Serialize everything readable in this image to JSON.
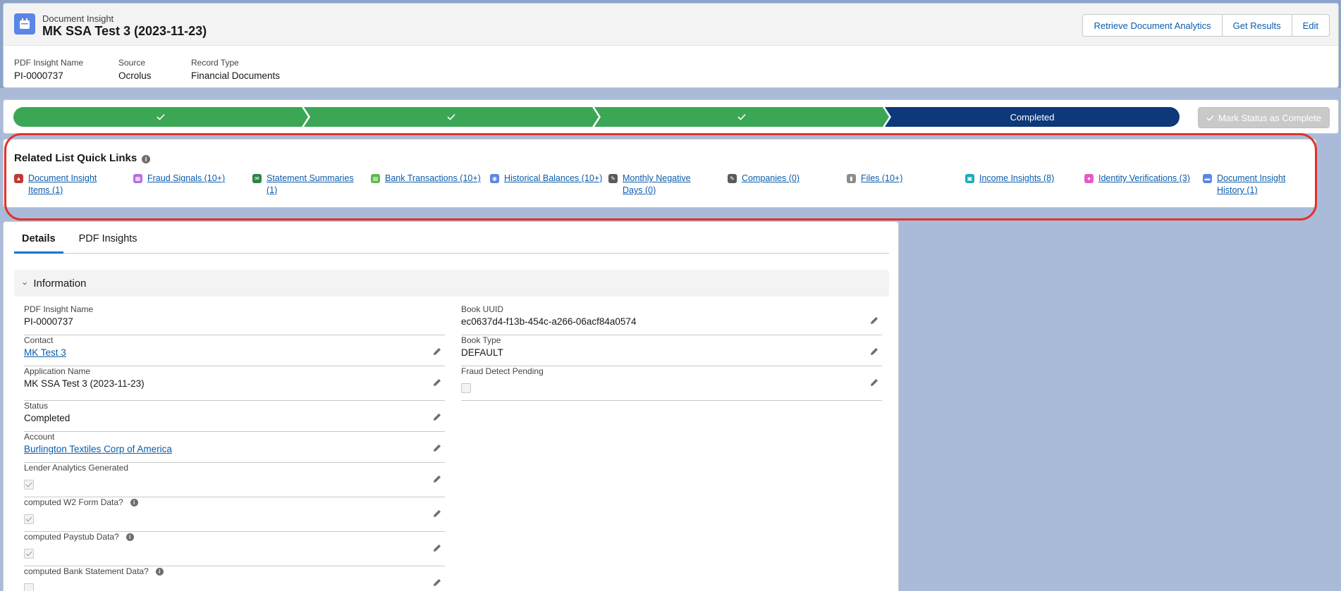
{
  "header": {
    "object_label": "Document Insight",
    "record_title": "MK SSA Test 3 (2023-11-23)",
    "buttons": {
      "retrieve": "Retrieve Document Analytics",
      "get_results": "Get Results",
      "edit": "Edit"
    },
    "highlights": [
      {
        "label": "PDF Insight Name",
        "value": "PI-0000737"
      },
      {
        "label": "Source",
        "value": "Ocrolus"
      },
      {
        "label": "Record Type",
        "value": "Financial Documents"
      }
    ]
  },
  "path": {
    "current_stage": "Completed",
    "mark_complete_label": "Mark Status as Complete"
  },
  "quick_links": {
    "title": "Related List Quick Links",
    "items": [
      {
        "label": "Document Insight Items (1)",
        "color": "#c23934"
      },
      {
        "label": "Fraud Signals (10+)",
        "color": "#b86ce9"
      },
      {
        "label": "Statement Summaries (1)",
        "color": "#2e844a"
      },
      {
        "label": "Bank Transactions (10+)",
        "color": "#62b74b"
      },
      {
        "label": "Historical Balances (10+)",
        "color": "#5a86e8"
      },
      {
        "label": "Monthly Negative Days (0)",
        "color": "#5a5a5a"
      },
      {
        "label": "Companies (0)",
        "color": "#5a5a5a"
      },
      {
        "label": "Files (10+)",
        "color": "#8c8c8c"
      },
      {
        "label": "Income Insights (8)",
        "color": "#1dabb8"
      },
      {
        "label": "Identity Verifications (3)",
        "color": "#e35bc6"
      },
      {
        "label": "Document Insight History (1)",
        "color": "#5a86e8"
      }
    ]
  },
  "tabs": [
    "Details",
    "PDF Insights"
  ],
  "section": {
    "title": "Information"
  },
  "fields_left": [
    {
      "label": "PDF Insight Name",
      "value": "PI-0000737"
    },
    {
      "label": "Contact",
      "value": "MK Test 3"
    },
    {
      "label": "Application Name",
      "value": "MK SSA Test 3 (2023-11-23)"
    },
    {
      "label": "Status",
      "value": "Completed"
    },
    {
      "label": "Account",
      "value": "Burlington Textiles Corp of America"
    },
    {
      "label": "Lender Analytics Generated",
      "value": ""
    },
    {
      "label": "computed W2 Form Data?",
      "value": ""
    },
    {
      "label": "computed Paystub Data?",
      "value": ""
    },
    {
      "label": "computed Bank Statement Data?",
      "value": ""
    }
  ],
  "fields_right": [
    {
      "label": "Book UUID",
      "value": "ec0637d4-f13b-454c-a266-06acf84a0574"
    },
    {
      "label": "Book Type",
      "value": "DEFAULT"
    },
    {
      "label": "Fraud Detect Pending",
      "value": ""
    }
  ]
}
